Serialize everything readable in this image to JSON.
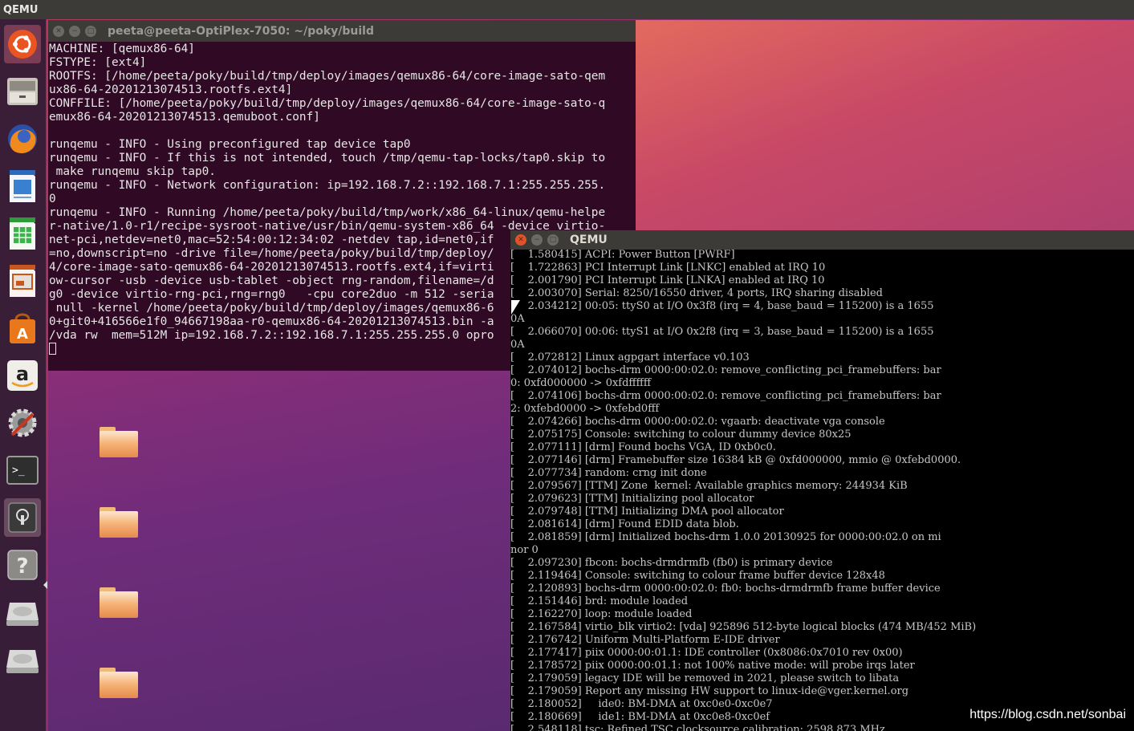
{
  "topbar": {
    "title": "QEMU"
  },
  "launcher": {
    "items": [
      {
        "name": "ubuntu-logo-icon"
      },
      {
        "name": "files-icon"
      },
      {
        "name": "firefox-icon"
      },
      {
        "name": "libreoffice-writer-icon"
      },
      {
        "name": "libreoffice-calc-icon"
      },
      {
        "name": "libreoffice-impress-icon"
      },
      {
        "name": "software-center-icon"
      },
      {
        "name": "amazon-icon"
      },
      {
        "name": "system-settings-icon"
      },
      {
        "name": "terminal-icon"
      },
      {
        "name": "qemu-app-icon"
      },
      {
        "name": "help-icon"
      },
      {
        "name": "drive-icon"
      },
      {
        "name": "drive-icon"
      }
    ]
  },
  "terminal": {
    "title": "peeta@peeta-OptiPlex-7050: ~/poky/build",
    "lines": [
      "MACHINE: [qemux86-64]",
      "FSTYPE: [ext4]",
      "ROOTFS: [/home/peeta/poky/build/tmp/deploy/images/qemux86-64/core-image-sato-qem",
      "ux86-64-20201213074513.rootfs.ext4]",
      "CONFFILE: [/home/peeta/poky/build/tmp/deploy/images/qemux86-64/core-image-sato-q",
      "emux86-64-20201213074513.qemuboot.conf]",
      "",
      "runqemu - INFO - Using preconfigured tap device tap0",
      "runqemu - INFO - If this is not intended, touch /tmp/qemu-tap-locks/tap0.skip to",
      " make runqemu skip tap0.",
      "runqemu - INFO - Network configuration: ip=192.168.7.2::192.168.7.1:255.255.255.",
      "0",
      "runqemu - INFO - Running /home/peeta/poky/build/tmp/work/x86_64-linux/qemu-helpe",
      "r-native/1.0-r1/recipe-sysroot-native/usr/bin/qemu-system-x86_64 -device virtio-",
      "net-pci,netdev=net0,mac=52:54:00:12:34:02 -netdev tap,id=net0,if",
      "=no,downscript=no -drive file=/home/peeta/poky/build/tmp/deploy/",
      "4/core-image-sato-qemux86-64-20201213074513.rootfs.ext4,if=virti",
      "ow-cursor -usb -device usb-tablet -object rng-random,filename=/d",
      "g0 -device virtio-rng-pci,rng=rng0   -cpu core2duo -m 512 -seria",
      " null -kernel /home/peeta/poky/build/tmp/deploy/images/qemux86-6",
      "0+git0+416566e1f0_94667198aa-r0-qemux86-64-20201213074513.bin -a",
      "/vda rw  mem=512M ip=192.168.7.2::192.168.7.1:255.255.255.0 opro",
      ""
    ]
  },
  "qemu": {
    "title": "QEMU",
    "lines": [
      "[    1.580415] ACPI: Power Button [PWRF]",
      "[    1.722863] PCI Interrupt Link [LNKC] enabled at IRQ 10",
      "[    2.001790] PCI Interrupt Link [LNKA] enabled at IRQ 10",
      "[    2.003070] Serial: 8250/16550 driver, 4 ports, IRQ sharing disabled",
      "[    2.034212] 00:05: ttyS0 at I/O 0x3f8 (irq = 4, base_baud = 115200) is a 1655",
      "0A",
      "[    2.066070] 00:06: ttyS1 at I/O 0x2f8 (irq = 3, base_baud = 115200) is a 1655",
      "0A",
      "[    2.072812] Linux agpgart interface v0.103",
      "[    2.074012] bochs-drm 0000:00:02.0: remove_conflicting_pci_framebuffers: bar",
      "0: 0xfd000000 -> 0xfdffffff",
      "[    2.074106] bochs-drm 0000:00:02.0: remove_conflicting_pci_framebuffers: bar",
      "2: 0xfebd0000 -> 0xfebd0fff",
      "[    2.074266] bochs-drm 0000:00:02.0: vgaarb: deactivate vga console",
      "[    2.075175] Console: switching to colour dummy device 80x25",
      "[    2.077111] [drm] Found bochs VGA, ID 0xb0c0.",
      "[    2.077146] [drm] Framebuffer size 16384 kB @ 0xfd000000, mmio @ 0xfebd0000.",
      "[    2.077734] random: crng init done",
      "[    2.079567] [TTM] Zone  kernel: Available graphics memory: 244934 KiB",
      "[    2.079623] [TTM] Initializing pool allocator",
      "[    2.079748] [TTM] Initializing DMA pool allocator",
      "[    2.081614] [drm] Found EDID data blob.",
      "[    2.081859] [drm] Initialized bochs-drm 1.0.0 20130925 for 0000:00:02.0 on mi",
      "nor 0",
      "[    2.097230] fbcon: bochs-drmdrmfb (fb0) is primary device",
      "[    2.119464] Console: switching to colour frame buffer device 128x48",
      "[    2.120893] bochs-drm 0000:00:02.0: fb0: bochs-drmdrmfb frame buffer device",
      "[    2.151446] brd: module loaded",
      "[    2.162270] loop: module loaded",
      "[    2.167584] virtio_blk virtio2: [vda] 925896 512-byte logical blocks (474 MB/452 MiB)",
      "[    2.176742] Uniform Multi-Platform E-IDE driver",
      "[    2.177417] piix 0000:00:01.1: IDE controller (0x8086:0x7010 rev 0x00)",
      "[    2.178572] piix 0000:00:01.1: not 100% native mode: will probe irqs later",
      "[    2.179059] legacy IDE will be removed in 2021, please switch to libata",
      "[    2.179059] Report any missing HW support to linux-ide@vger.kernel.org",
      "[    2.180052]     ide0: BM-DMA at 0xc0e0-0xc0e7",
      "[    2.180669]     ide1: BM-DMA at 0xc0e8-0xc0ef",
      "[    2.548118] tsc: Refined TSC clocksource calibration: 2598.873 MHz"
    ]
  },
  "watermark": "https://blog.csdn.net/sonbai"
}
